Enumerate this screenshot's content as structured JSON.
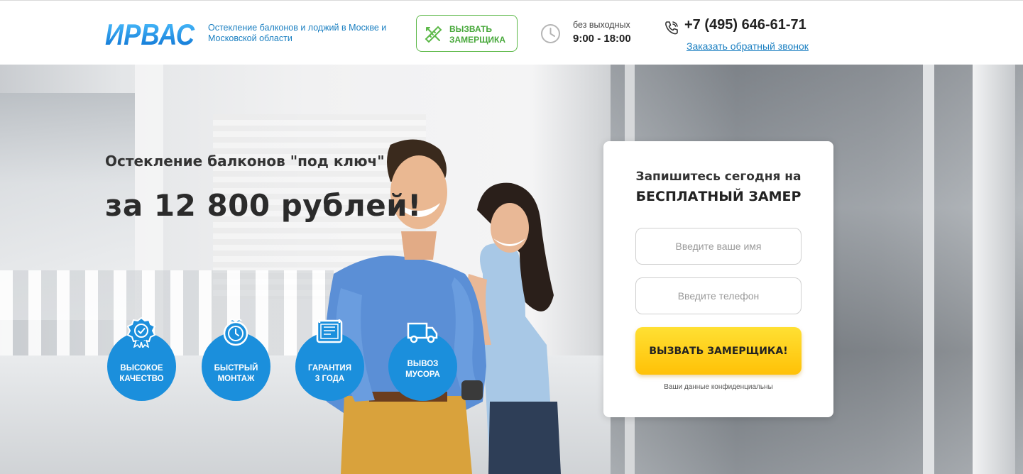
{
  "header": {
    "logo_text": "ИРВАС",
    "tagline": "Остекление балконов и лоджий в Москве и Московской области",
    "call_button_line1": "ВЫЗВАТЬ",
    "call_button_line2": "ЗАМЕРЩИКА",
    "hours_label": "без выходных",
    "hours_value": "9:00 - 18:00",
    "phone": "+7 (495) 646-61-71",
    "callback_link": "Заказать обратный звонок"
  },
  "hero": {
    "subtitle": "Остекление балконов \"под ключ\"",
    "price": "за 12 800 рублей!",
    "features": [
      {
        "line1": "ВЫСОКОЕ",
        "line2": "КАЧЕСТВО",
        "icon": "quality-badge-icon"
      },
      {
        "line1": "БЫСТРЫЙ",
        "line2": "МОНТАЖ",
        "icon": "stopwatch-icon"
      },
      {
        "line1": "ГАРАНТИЯ",
        "line2": "3 ГОДА",
        "icon": "certificate-icon"
      },
      {
        "line1": "ВЫВОЗ",
        "line2": "МУСОРА",
        "icon": "truck-icon"
      }
    ]
  },
  "form": {
    "title_line1": "Запишитесь сегодня на",
    "title_line2": "БЕСПЛАТНЫЙ ЗАМЕР",
    "name_placeholder": "Введите ваше имя",
    "phone_placeholder": "Введите телефон",
    "submit_label": "ВЫЗВАТЬ ЗАМЕРЩИКА!",
    "privacy_note": "Ваши данные конфиденциальны"
  },
  "colors": {
    "brand_blue": "#1b8fdc",
    "accent_green": "#5bb847",
    "button_yellow": "#ffc107"
  }
}
